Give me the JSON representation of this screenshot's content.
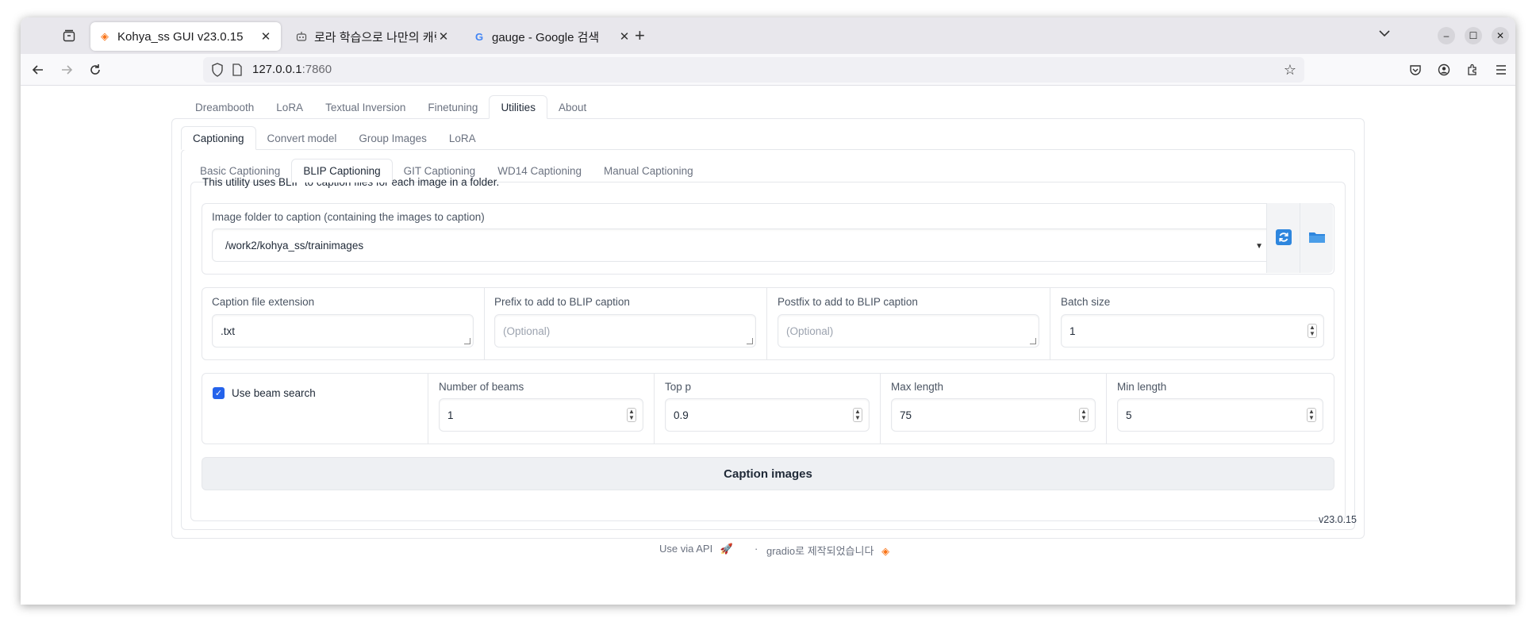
{
  "browser": {
    "tabs": [
      {
        "title": "Kohya_ss GUI v23.0.15",
        "favicon": "gradio-icon",
        "active": true
      },
      {
        "title": "로라 학습으로 나만의 캐릭터",
        "favicon": "robot-icon",
        "active": false
      },
      {
        "title": "gauge - Google 검색",
        "favicon": "google-icon",
        "active": false
      }
    ],
    "url_host": "127.0.0.1",
    "url_port": ":7860"
  },
  "main_tabs": [
    "Dreambooth",
    "LoRA",
    "Textual Inversion",
    "Finetuning",
    "Utilities",
    "About"
  ],
  "main_tab_active": "Utilities",
  "sub_tabs": [
    "Captioning",
    "Convert model",
    "Group Images",
    "LoRA"
  ],
  "sub_tab_active": "Captioning",
  "caption_tabs": [
    "Basic Captioning",
    "BLIP Captioning",
    "GIT Captioning",
    "WD14 Captioning",
    "Manual Captioning"
  ],
  "caption_tab_active": "BLIP Captioning",
  "description": "This utility uses BLIP to caption files for each image in a folder.",
  "image_folder": {
    "label": "Image folder to caption (containing the images to caption)",
    "value": "/work2/kohya_ss/trainimages"
  },
  "caption_ext": {
    "label": "Caption file extension",
    "value": ".txt"
  },
  "prefix": {
    "label": "Prefix to add to BLIP caption",
    "placeholder": "(Optional)"
  },
  "postfix": {
    "label": "Postfix to add to BLIP caption",
    "placeholder": "(Optional)"
  },
  "batch_size": {
    "label": "Batch size",
    "value": "1"
  },
  "beam_search": {
    "label": "Use beam search",
    "checked": true
  },
  "num_beams": {
    "label": "Number of beams",
    "value": "1"
  },
  "top_p": {
    "label": "Top p",
    "value": "0.9"
  },
  "max_length": {
    "label": "Max length",
    "value": "75"
  },
  "min_length": {
    "label": "Min length",
    "value": "5"
  },
  "caption_button": "Caption images",
  "version": "v23.0.15",
  "footer": {
    "use_api": "Use via API",
    "separator": "·",
    "built_with": "gradio로 제작되었습니다"
  },
  "colors": {
    "accent": "#2563eb",
    "tab_orange": "#f97316"
  }
}
